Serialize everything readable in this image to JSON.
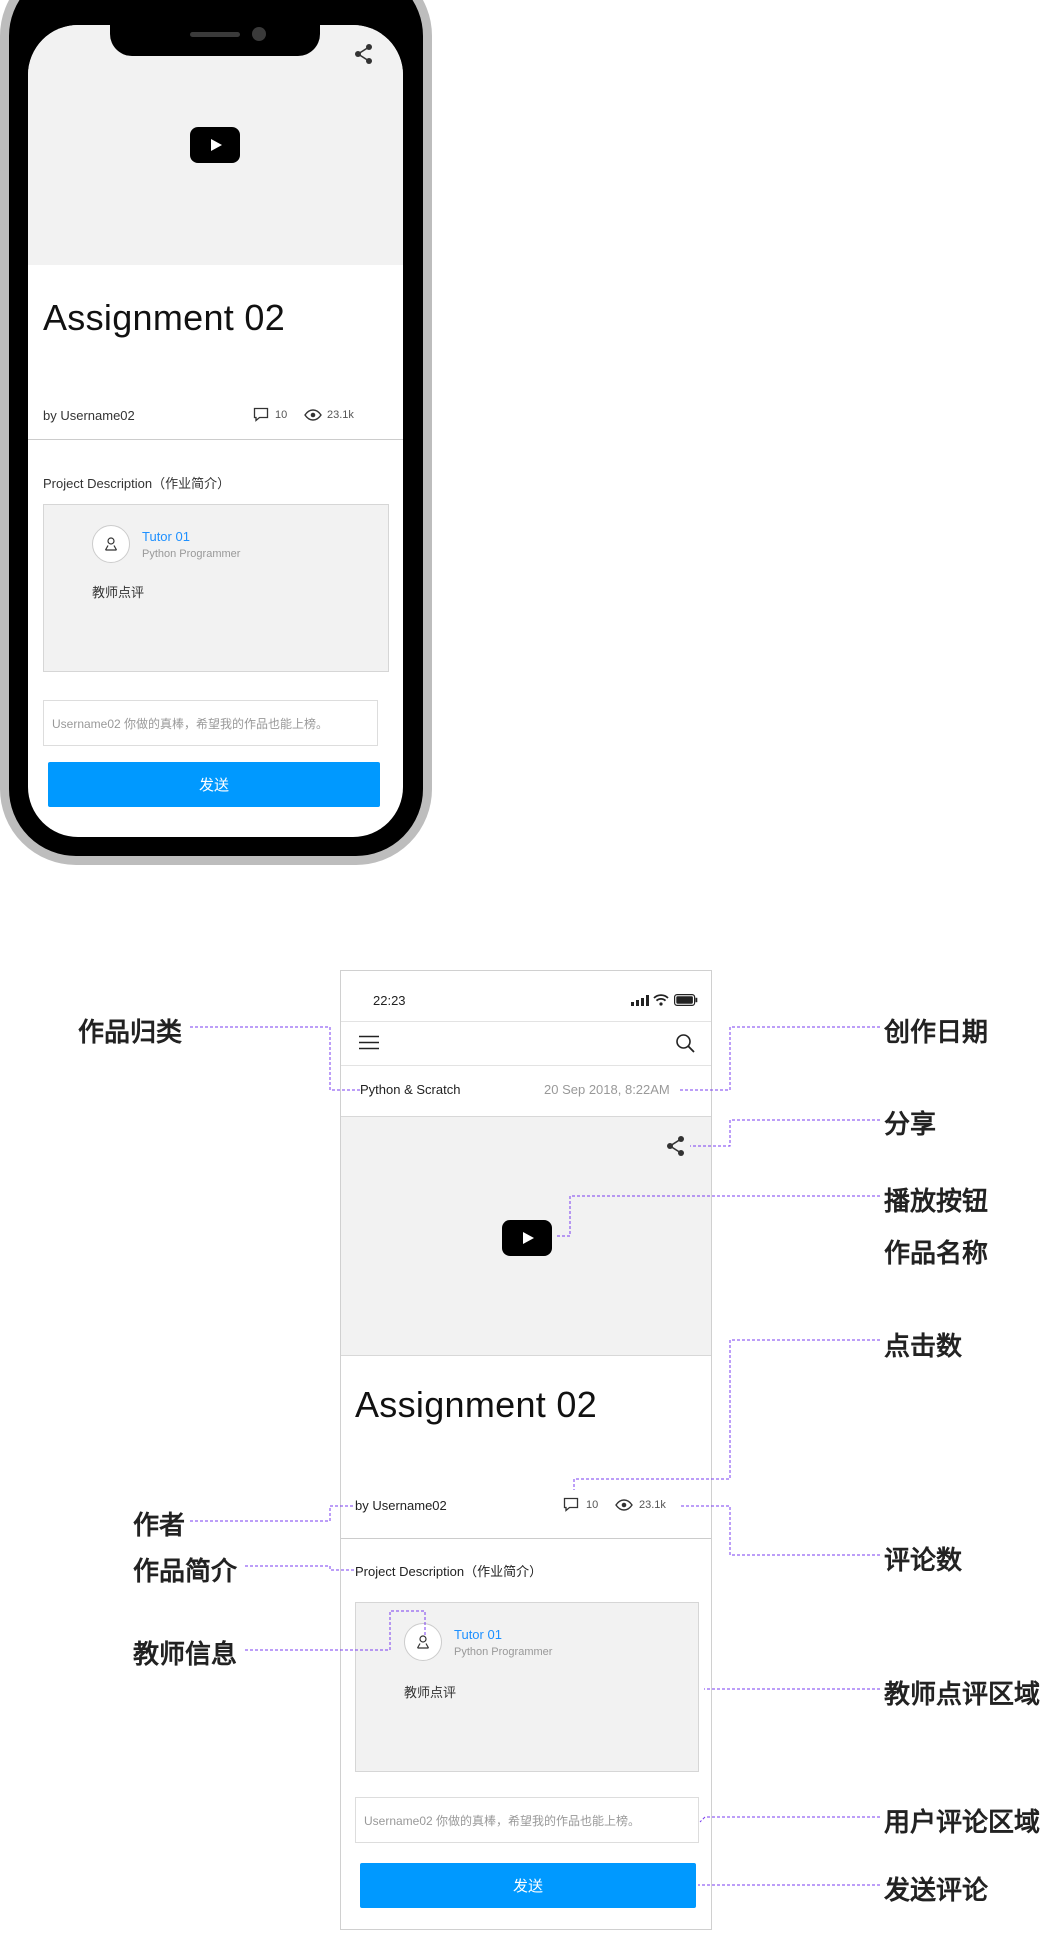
{
  "mockup": {
    "title": "Assignment 02",
    "author": "by Username02",
    "comment_count": "10",
    "view_count": "23.1k",
    "description_label": "Project Description（作业简介）",
    "tutor_name": "Tutor 01",
    "tutor_role": "Python Programmer",
    "tutor_review": "教师点评",
    "comment_placeholder": "Username02 你做的真棒，希望我的作品也能上榜。",
    "send_label": "发送"
  },
  "wireframe": {
    "status_time": "22:23",
    "category": "Python & Scratch",
    "date": "20 Sep 2018, 8:22AM",
    "title": "Assignment 02",
    "author": "by Username02",
    "comment_count": "10",
    "view_count": "23.1k",
    "description_label": "Project Description（作业简介）",
    "tutor_name": "Tutor 01",
    "tutor_role": "Python Programmer",
    "tutor_review": "教师点评",
    "comment_placeholder": "Username02 你做的真棒，希望我的作品也能上榜。",
    "send_label": "发送"
  },
  "annotations": {
    "category": "作品归类",
    "author": "作者",
    "description": "作品简介",
    "tutor_info": "教师信息",
    "date": "创作日期",
    "share": "分享",
    "play": "播放按钮",
    "title": "作品名称",
    "views": "点击数",
    "comments": "评论数",
    "review_area": "教师点评区域",
    "user_comment_area": "用户评论区域",
    "send_comment": "发送评论"
  },
  "colors": {
    "accent_blue": "#0099ff",
    "link_blue": "#1e90ff",
    "annotation_line": "#7a3cf0"
  }
}
